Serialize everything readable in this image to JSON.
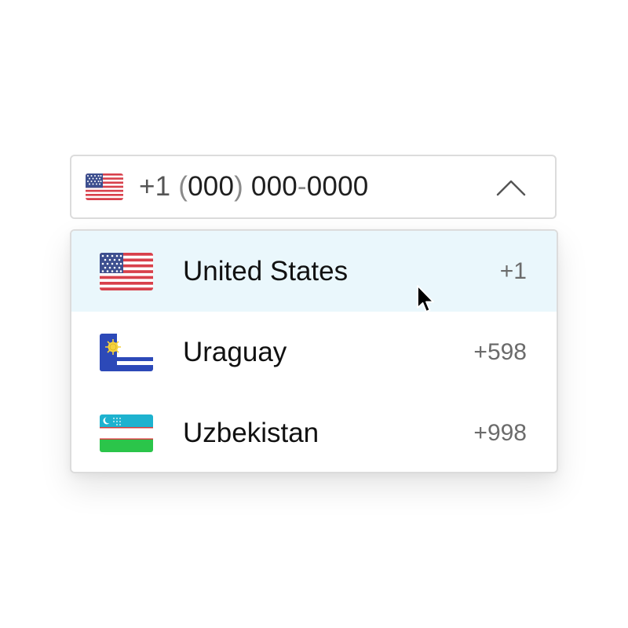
{
  "phone_field": {
    "selected_country_flag": "flag-us-icon",
    "country_prefix": "+1",
    "mask": {
      "open_paren": "(",
      "area": "000",
      "close_paren": ")",
      "first": "000",
      "dash": "-",
      "last": "0000"
    },
    "toggle_icon": "chevron-up-icon"
  },
  "dropdown": {
    "options": [
      {
        "name": "United States",
        "code": "+1",
        "flag": "flag-us-icon",
        "highlighted": true
      },
      {
        "name": "Uraguay",
        "code": "+598",
        "flag": "flag-uy-icon",
        "highlighted": false
      },
      {
        "name": "Uzbekistan",
        "code": "+998",
        "flag": "flag-uz-icon",
        "highlighted": false
      }
    ]
  },
  "colors": {
    "highlight_bg": "#eaf7fc",
    "border": "#dcdcdc",
    "code_text": "#6b6b6b"
  },
  "pointer": "arrow-cursor-icon"
}
